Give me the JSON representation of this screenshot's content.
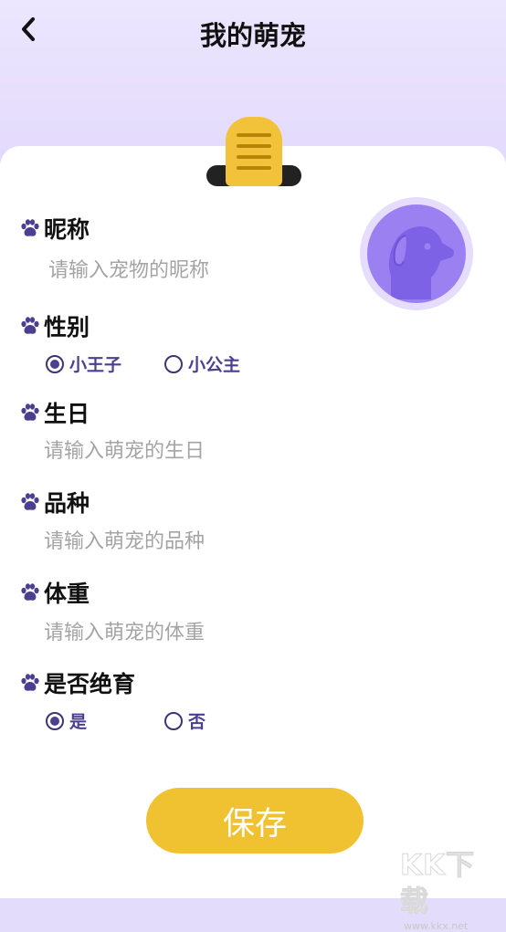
{
  "header": {
    "title": "我的萌宠"
  },
  "fields": {
    "nickname": {
      "label": "昵称",
      "placeholder": "请输入宠物的昵称",
      "value": ""
    },
    "gender": {
      "label": "性别",
      "options": [
        {
          "label": "小王子",
          "checked": true
        },
        {
          "label": "小公主",
          "checked": false
        }
      ]
    },
    "birthday": {
      "label": "生日",
      "placeholder": "请输入萌宠的生日",
      "value": ""
    },
    "breed": {
      "label": "品种",
      "placeholder": "请输入萌宠的品种",
      "value": ""
    },
    "weight": {
      "label": "体重",
      "placeholder": "请输入萌宠的体重",
      "value": ""
    },
    "neutered": {
      "label": "是否绝育",
      "options": [
        {
          "label": "是",
          "checked": true
        },
        {
          "label": "否",
          "checked": false
        }
      ]
    }
  },
  "save_button": {
    "label": "保存"
  },
  "watermark": {
    "logo": "KK下载",
    "url": "www.kkx.net"
  },
  "colors": {
    "header_bg": "#e4dcfb",
    "accent_yellow": "#f0c232",
    "accent_purple": "#9b80f1",
    "radio_text": "#4b3f90"
  },
  "icons": {
    "back": "chevron-left-icon",
    "paw": "paw-icon",
    "avatar": "dog-icon",
    "clipboard": "clipboard-clip-icon"
  }
}
